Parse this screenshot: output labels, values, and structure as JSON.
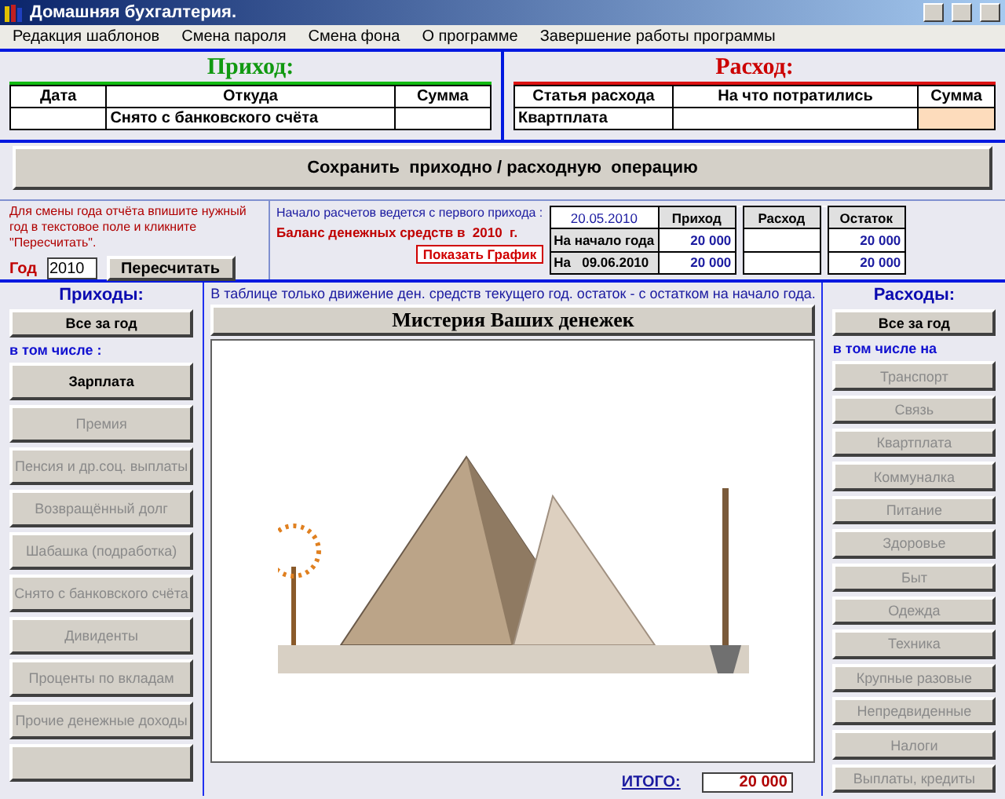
{
  "window": {
    "title": "Домашняя бухгалтерия."
  },
  "menu": [
    "Редакция шаблонов",
    "Смена пароля",
    "Смена фона",
    "О программе",
    "Завершение работы программы"
  ],
  "income_entry": {
    "title": "Приход:",
    "columns": [
      "Дата",
      "Откуда",
      "Сумма"
    ],
    "row": {
      "source": "Снято с банковского счёта"
    }
  },
  "expense_entry": {
    "title": "Расход:",
    "columns": [
      "Статья расхода",
      "На что потратились",
      "Сумма"
    ],
    "row": {
      "category": "Квартплата"
    }
  },
  "save_button": "Сохранить  приходно / расходную  операцию",
  "year_panel": {
    "hint": "Для смены года отчёта впишите нужный год в текстовое поле и кликните \"Пересчитать\".",
    "year_label": "Год",
    "year": "2010",
    "recalc_button": "Пересчитать"
  },
  "balance": {
    "note": "Начало расчетов ведется с первого прихода :",
    "title": "Баланс денежных средств в  2010  г.",
    "chart_button": "Показать График",
    "start_date": "20.05.2010",
    "columns": [
      "Приход",
      "Расход",
      "Остаток"
    ],
    "rows": [
      {
        "label": "На начало года",
        "income": "20 000",
        "balance": "20 000"
      },
      {
        "label": "На",
        "date": "09.06.2010",
        "income": "20 000",
        "balance": "20 000"
      }
    ]
  },
  "income": {
    "title": "Приходы:",
    "all_button": "Все за год",
    "subtitle": "в том числе :",
    "buttons": [
      {
        "kind": "text",
        "label": "Зарплата",
        "disabled": false
      },
      {
        "kind": "text",
        "label": "Премия",
        "disabled": true
      },
      {
        "kind": "text",
        "label": "Пенсия и др.соц. выплаты",
        "disabled": true
      },
      {
        "kind": "text",
        "label": "Возвращённый долг",
        "disabled": true
      },
      {
        "kind": "text",
        "label": "Шабашка (подработка)",
        "disabled": true
      },
      {
        "kind": "text",
        "label": "Снято с банковского счёта",
        "disabled": true
      },
      {
        "kind": "text",
        "label": "Дивиденты",
        "disabled": true
      },
      {
        "kind": "text",
        "label": "Проценты по вкладам",
        "disabled": true
      },
      {
        "kind": "text",
        "label": "Прочие денежные доходы",
        "disabled": true
      },
      {
        "kind": "blank"
      }
    ]
  },
  "center": {
    "note": "В таблице только движение ден. средств текущего год.  остаток - с остатком на начало года.",
    "title": "Мистерия Ваших денежек",
    "total_label": "ИТОГО:",
    "total": "20 000"
  },
  "expenses": {
    "title": "Расходы:",
    "all_button": "Все за год",
    "subtitle": "в том числе на",
    "buttons": [
      {
        "label": "Транспорт",
        "disabled": true
      },
      {
        "label": "Связь",
        "disabled": true
      },
      {
        "label": "Квартплата",
        "disabled": true
      },
      {
        "label": "Коммуналка",
        "disabled": true
      },
      {
        "label": "Питание",
        "disabled": true
      },
      {
        "label": "Здоровье",
        "disabled": true
      },
      {
        "label": "Быт",
        "disabled": true
      },
      {
        "label": "Одежда",
        "disabled": true
      },
      {
        "label": "Техника",
        "disabled": true
      },
      {
        "label": "Крупные разовые",
        "disabled": true
      },
      {
        "label": "Непредвиденные",
        "disabled": true
      },
      {
        "label": "Налоги",
        "disabled": true
      },
      {
        "label": "Выплаты, кредиты",
        "disabled": true
      }
    ]
  }
}
